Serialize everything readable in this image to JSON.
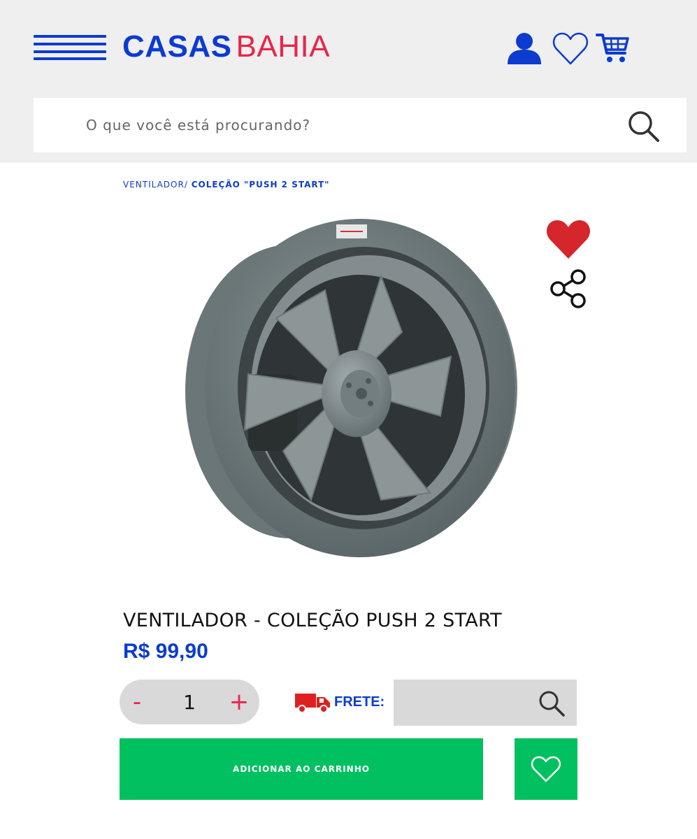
{
  "header": {
    "logo_primary": "CASAS",
    "logo_secondary": "BAHIA",
    "icons": [
      "menu-icon",
      "user-icon",
      "heart-icon",
      "cart-icon"
    ]
  },
  "search": {
    "placeholder": "O que você está procurando?",
    "value": ""
  },
  "breadcrumb": {
    "category": "VENTILADOR/",
    "current": "COLEÇÃO \"PUSH 2 START\""
  },
  "product": {
    "image_alt": "Ventilador axial industrial cinza",
    "title": "VENTILADOR - COLEÇÃO PUSH 2 START",
    "price": "R$ 99,90",
    "favorited": true
  },
  "purchase": {
    "decrement_label": "-",
    "increment_label": "+",
    "quantity": "1",
    "shipping_label": "FRETE:",
    "shipping_value": "",
    "add_to_cart_label": "ADICIONAR AO CARRINHO"
  },
  "colors": {
    "brand_blue": "#0d3bd0",
    "brand_red": "#e8254a",
    "cta_green": "#00c060",
    "favorite_red": "#d4262b",
    "header_bg": "#efeff0"
  }
}
